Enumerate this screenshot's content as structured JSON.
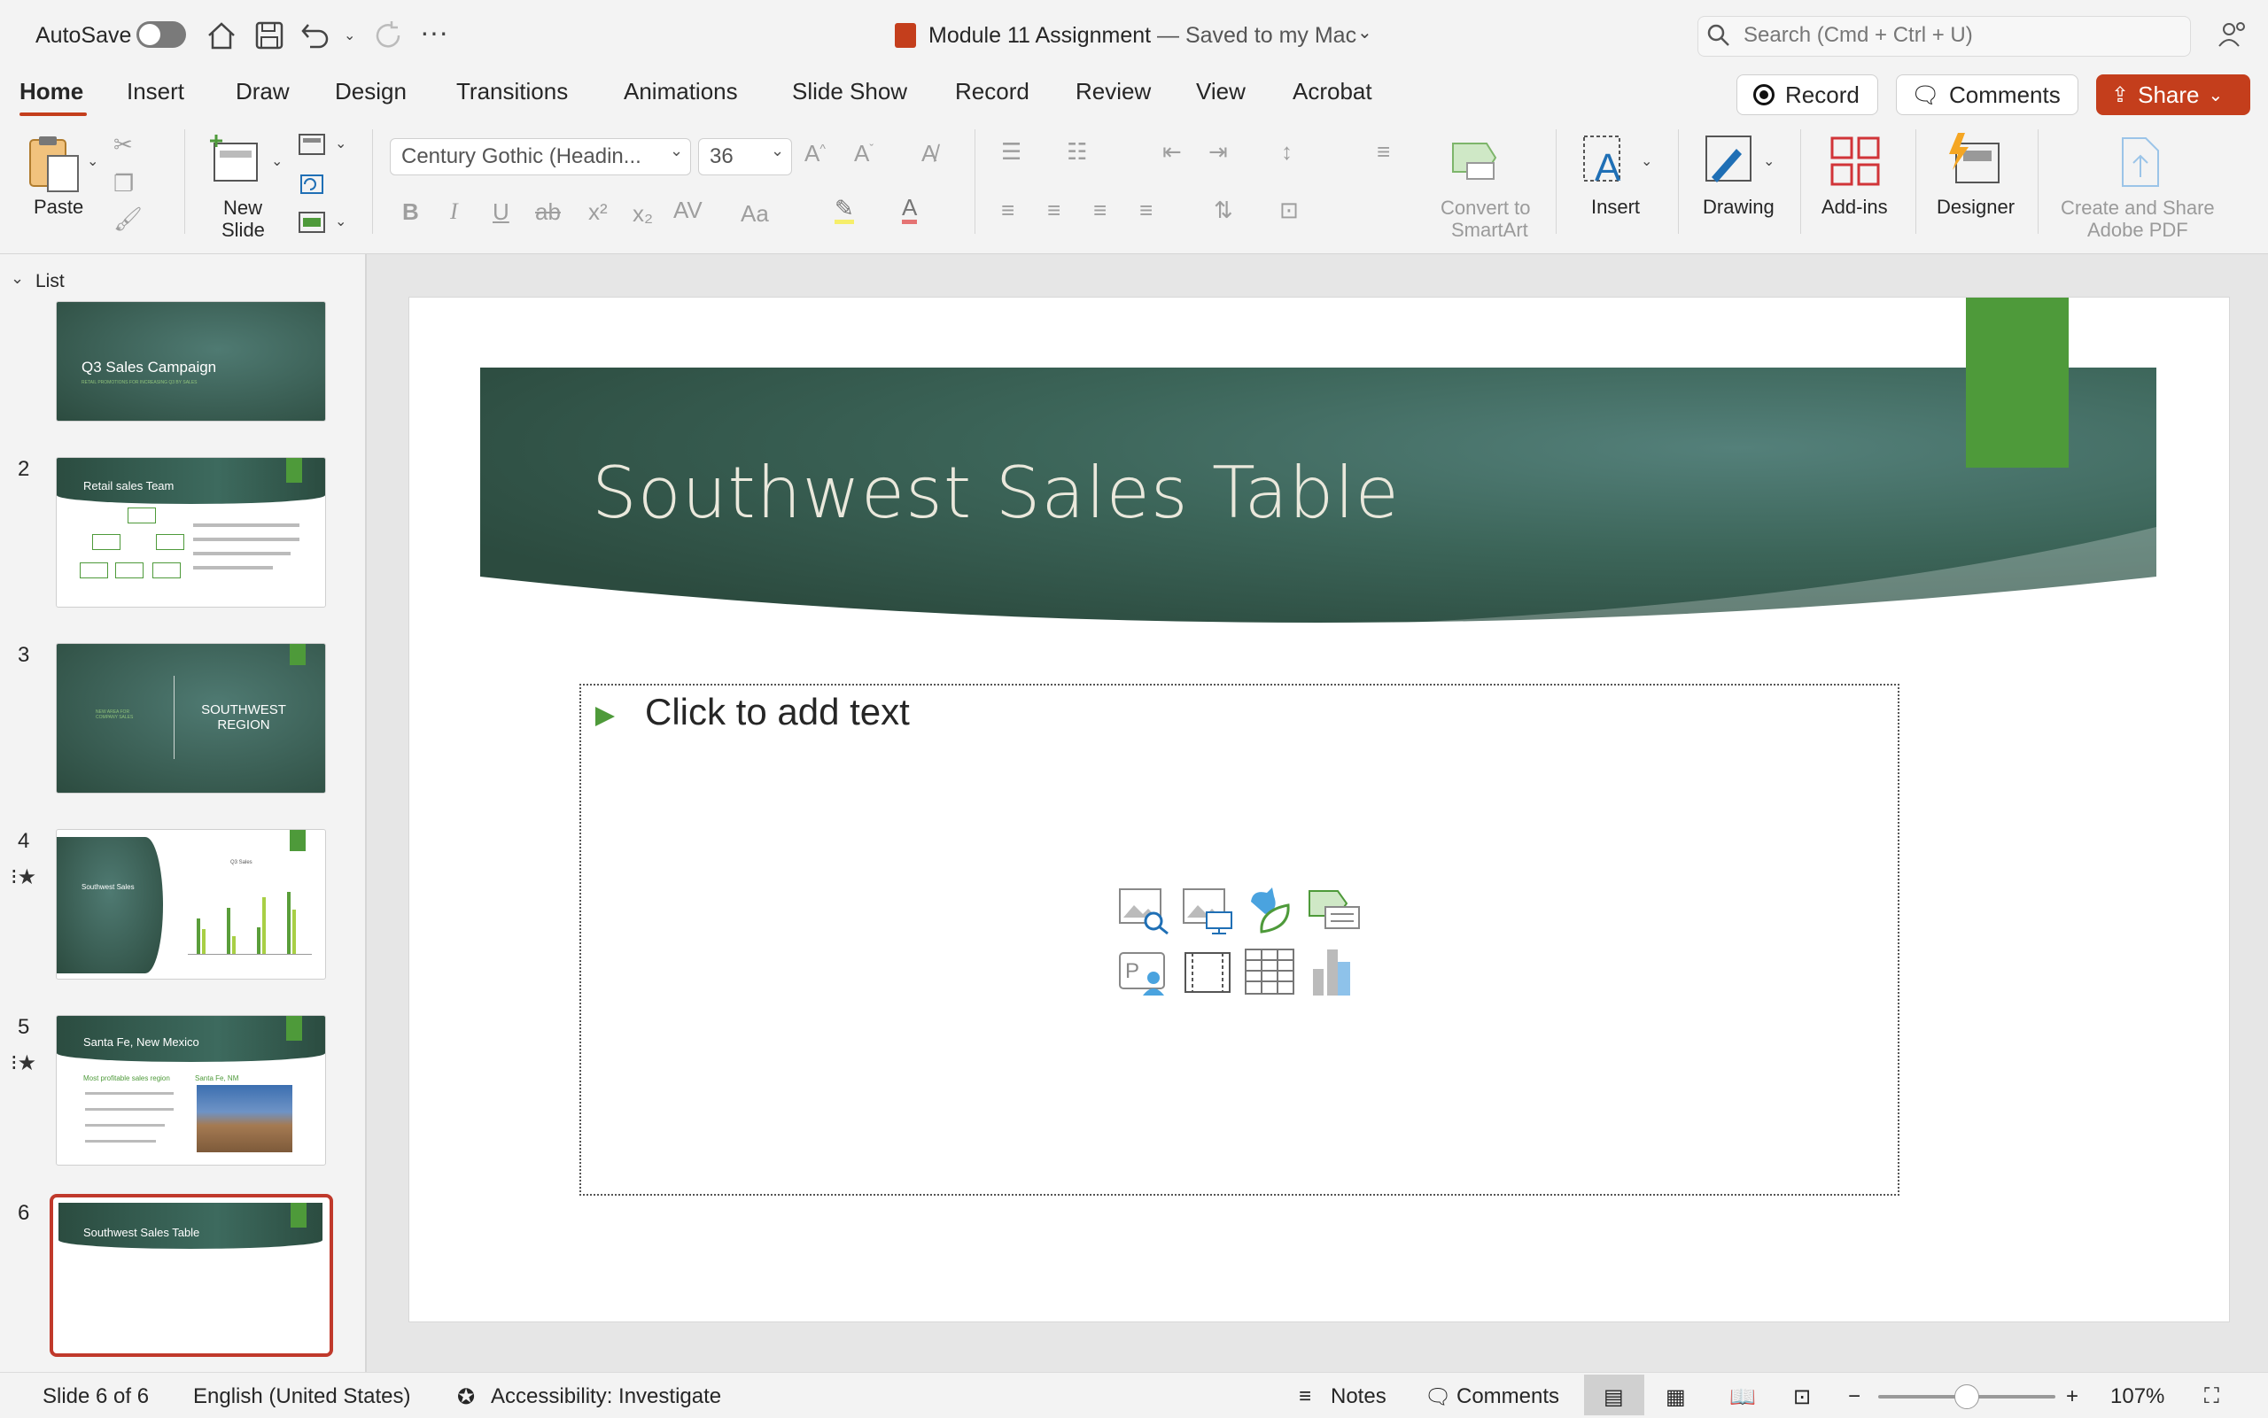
{
  "titlebar": {
    "autosave_label": "AutoSave",
    "doc_title": "Module 11 Assignment",
    "saved_status": "— Saved to my Mac",
    "search_placeholder": "Search (Cmd + Ctrl + U)"
  },
  "tabs": [
    "Home",
    "Insert",
    "Draw",
    "Design",
    "Transitions",
    "Animations",
    "Slide Show",
    "Record",
    "Review",
    "View",
    "Acrobat"
  ],
  "actions": {
    "record": "Record",
    "comments": "Comments",
    "share": "Share"
  },
  "ribbon": {
    "paste": "Paste",
    "new_slide_1": "New",
    "new_slide_2": "Slide",
    "font_name": "Century Gothic (Headin...",
    "font_size": "36",
    "convert_1": "Convert to",
    "convert_2": "SmartArt",
    "insert": "Insert",
    "drawing": "Drawing",
    "addins": "Add-ins",
    "designer": "Designer",
    "pdf_1": "Create and Share",
    "pdf_2": "Adobe PDF"
  },
  "panel": {
    "list_label": "List",
    "slides": [
      {
        "num": "",
        "title": "Q3 Sales Campaign",
        "subtitle": "RETAIL PROMOTIONS FOR INCREASING Q3 BY SALES"
      },
      {
        "num": "2",
        "title": "Retail sales Team"
      },
      {
        "num": "3",
        "left": "NEW AREA FOR COMPANY SALES",
        "right": "SOUTHWEST REGION"
      },
      {
        "num": "4",
        "title": "Southwest Sales",
        "chart_title": "Q3 Sales"
      },
      {
        "num": "5",
        "title": "Santa Fe, New Mexico",
        "sub1": "Most profitable sales region",
        "sub2": "Santa Fe, NM"
      },
      {
        "num": "6",
        "title": "Southwest Sales Table"
      }
    ]
  },
  "slide": {
    "title": "Southwest Sales Table",
    "placeholder": "Click to add text"
  },
  "status": {
    "slide_count": "Slide 6 of 6",
    "language": "English (United States)",
    "accessibility": "Accessibility: Investigate",
    "notes": "Notes",
    "comments": "Comments",
    "zoom": "107%"
  },
  "colors": {
    "accent": "#c43e1c",
    "slide_green": "#4e9a3a",
    "band_dark": "#2c4b3f"
  }
}
